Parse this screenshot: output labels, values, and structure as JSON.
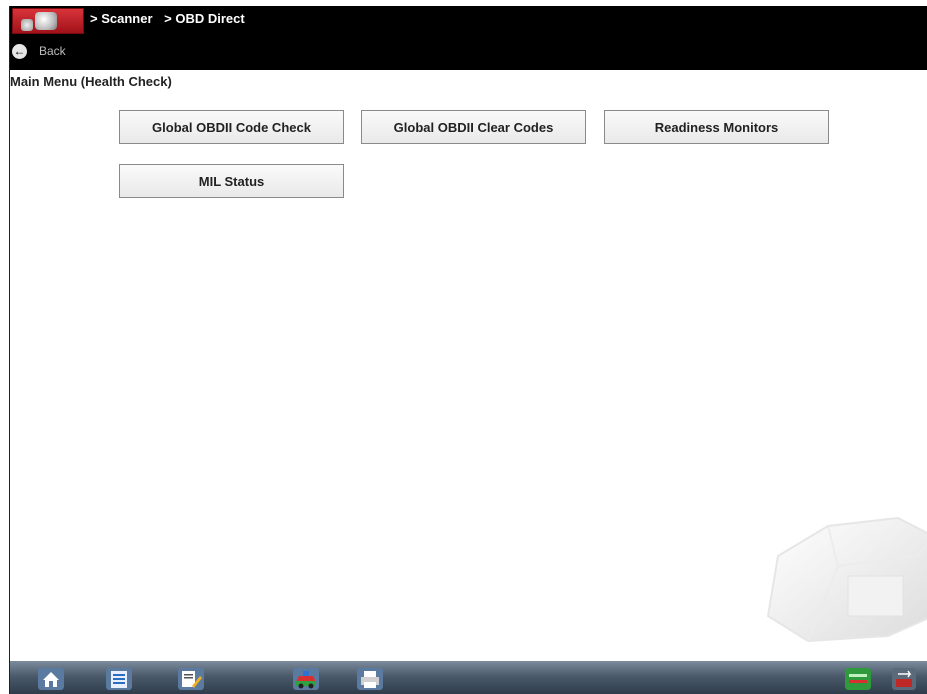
{
  "header": {
    "breadcrumb": [
      "> Scanner",
      "> OBD Direct"
    ],
    "back_label": "Back"
  },
  "main": {
    "title": "Main Menu (Health Check)",
    "buttons": [
      {
        "label": "Global OBDII Code Check"
      },
      {
        "label": "Global OBDII Clear Codes"
      },
      {
        "label": "Readiness Monitors"
      },
      {
        "label": "MIL Status"
      }
    ]
  },
  "taskbar": {
    "icons": [
      "home-icon",
      "data-list-icon",
      "edit-icon",
      "vehicle-icon",
      "printer-icon",
      "connection-status-icon",
      "power-icon"
    ]
  },
  "colors": {
    "header_bg": "#000000",
    "accent_red": "#c8202a",
    "taskbar_blue": "#3e4e5e"
  }
}
